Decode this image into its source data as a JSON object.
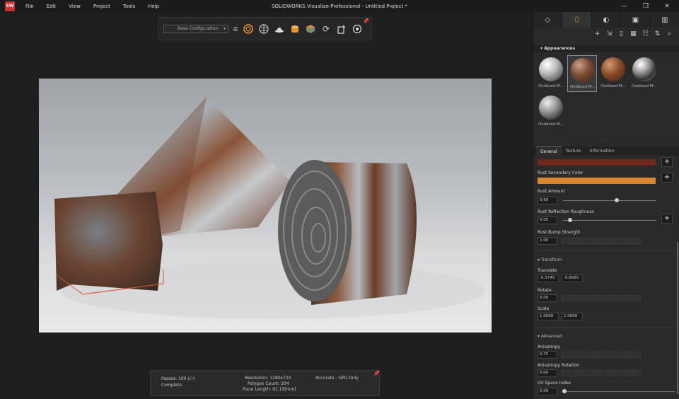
{
  "titlebar": {
    "logo": "SW",
    "menus": [
      "File",
      "Edit",
      "View",
      "Project",
      "Tools",
      "Help"
    ],
    "title": "SOLIDWORKS Visualize-Professional - Untitled Project *",
    "minimize": "—",
    "restore": "❐",
    "close": "✕"
  },
  "toolbar": {
    "configuration": "Base Configuration",
    "icons": [
      "render-mode-icon",
      "brain-icon",
      "environment-icon",
      "camera-icon",
      "cube-icon",
      "refresh-icon",
      "export-icon",
      "settings-icon"
    ],
    "accent": "#e8922e"
  },
  "statusbar": {
    "passes_label": "Passes: 100 /",
    "passes_value": "100",
    "status": "Complete",
    "resolution": "Resolution: 1280x720",
    "polygon": "Polygon Count: 204",
    "focal": "Focal Length: 91.15[mm]",
    "mode": "Accurate - GPU Only"
  },
  "panel": {
    "tabs": [
      "models-icon",
      "appearances-icon",
      "environment-icon",
      "cameras-icon",
      "libraries-icon"
    ],
    "section": "Appearances",
    "thumbs": [
      "Oxidized M...",
      "Oxidized M...",
      "Oxidized M...",
      "Oxidized M...",
      "Oxidized M..."
    ],
    "prop_tabs": [
      "General",
      "Texture",
      "Information"
    ],
    "rust_secondary": "Rust Secondary Color",
    "rust_amount": "Rust Amount",
    "rust_amount_val": "0.50",
    "rust_refl": "Rust Reflection Roughness",
    "rust_refl_val": "0.05",
    "rust_bump": "Rust Bump Strength",
    "rust_bump_val": "1.00",
    "transform": "Transform",
    "translate": "Translate",
    "translate_x": "-0.5745",
    "translate_y": "-0.6665",
    "rotate": "Rotate",
    "rotate_val": "0.00",
    "scale": "Scale",
    "scale_x": "1.0000",
    "scale_y": "1.0000",
    "advanced": "Advanced",
    "aniso": "Anisotropy",
    "aniso_val": "0.75",
    "aniso_rot": "Anisotropy Rotation",
    "aniso_rot_val": "0.00",
    "uv": "UV Space Index",
    "uv_val": "0.00",
    "color_primary": "#6e2a1c",
    "color_secondary": "#d9862c"
  }
}
